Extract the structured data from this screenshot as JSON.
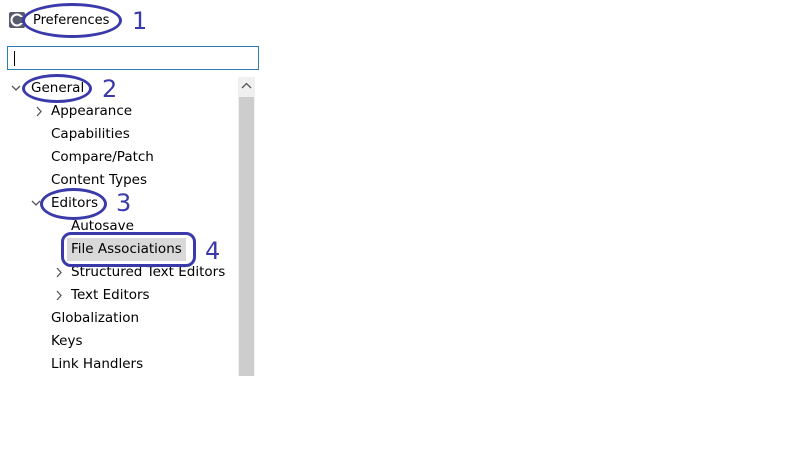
{
  "window": {
    "title": "Preferences",
    "icon": "eclipse-app-icon"
  },
  "filter": {
    "value": "",
    "placeholder": ""
  },
  "tree": {
    "items": [
      {
        "label": "General",
        "expander": "expanded"
      },
      {
        "label": "Appearance",
        "expander": "collapsed"
      },
      {
        "label": "Capabilities",
        "expander": "none"
      },
      {
        "label": "Compare/Patch",
        "expander": "none"
      },
      {
        "label": "Content Types",
        "expander": "none"
      },
      {
        "label": "Editors",
        "expander": "expanded"
      },
      {
        "label": "Autosave",
        "expander": "none"
      },
      {
        "label": "File Associations",
        "expander": "none",
        "selected": true
      },
      {
        "label": "Structured Text Editors",
        "expander": "collapsed"
      },
      {
        "label": "Text Editors",
        "expander": "collapsed"
      },
      {
        "label": "Globalization",
        "expander": "none"
      },
      {
        "label": "Keys",
        "expander": "none"
      },
      {
        "label": "Link Handlers",
        "expander": "none"
      }
    ]
  },
  "annotations": {
    "steps": [
      "1",
      "2",
      "3",
      "4"
    ],
    "color": "#3a3aaa"
  },
  "colors": {
    "selection": "#d9d9d9",
    "filter_border": "#2d7db3",
    "scrollbar_track": "#f0f0f0",
    "scrollbar_thumb": "#cdcdcd"
  }
}
